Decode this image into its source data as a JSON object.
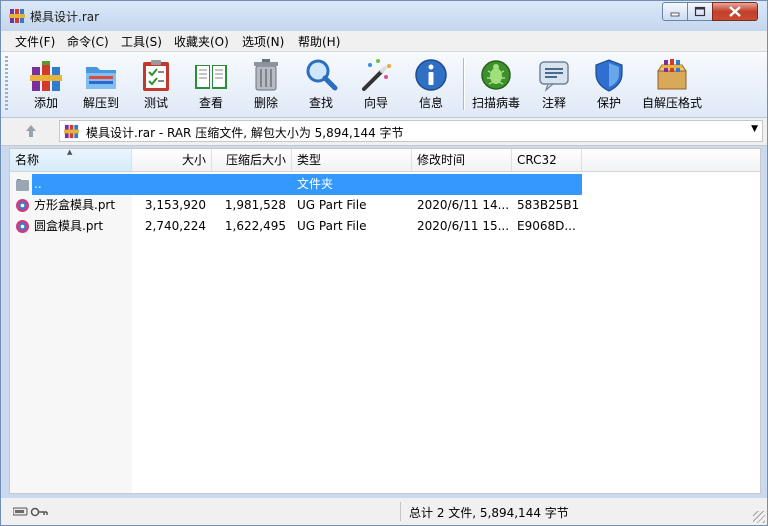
{
  "window": {
    "title": "模具设计.rar"
  },
  "menu": [
    "文件(F)",
    "命令(C)",
    "工具(S)",
    "收藏夹(O)",
    "选项(N)",
    "帮助(H)"
  ],
  "toolbar": [
    {
      "label": "添加",
      "icon": "add-archive-icon"
    },
    {
      "label": "解压到",
      "icon": "extract-folder-icon"
    },
    {
      "label": "测试",
      "icon": "test-clipboard-icon"
    },
    {
      "label": "查看",
      "icon": "view-book-icon"
    },
    {
      "label": "删除",
      "icon": "delete-trash-icon"
    },
    {
      "label": "查找",
      "icon": "find-magnifier-icon"
    },
    {
      "label": "向导",
      "icon": "wizard-wand-icon"
    },
    {
      "label": "信息",
      "icon": "info-icon"
    },
    {
      "label": "扫描病毒",
      "icon": "virus-scan-icon"
    },
    {
      "label": "注释",
      "icon": "comment-icon"
    },
    {
      "label": "保护",
      "icon": "shield-icon"
    },
    {
      "label": "自解压格式",
      "icon": "sfx-box-icon"
    }
  ],
  "address": {
    "text": "模具设计.rar - RAR 压缩文件, 解包大小为 5,894,144 字节"
  },
  "columns": [
    "名称",
    "大小",
    "压缩后大小",
    "类型",
    "修改时间",
    "CRC32"
  ],
  "rows": [
    {
      "name": "..",
      "size": "",
      "packed": "",
      "type": "文件夹",
      "modified": "",
      "crc": "",
      "selected": true
    },
    {
      "name": "方形盒模具.prt",
      "size": "3,153,920",
      "packed": "1,981,528",
      "type": "UG Part File",
      "modified": "2020/6/11 14...",
      "crc": "583B25B1",
      "selected": false
    },
    {
      "name": "圆盒模具.prt",
      "size": "2,740,224",
      "packed": "1,622,495",
      "type": "UG Part File",
      "modified": "2020/6/11 15...",
      "crc": "E9068D...",
      "selected": false
    }
  ],
  "status": {
    "text": "总计 2 文件, 5,894,144 字节"
  },
  "colors": {
    "selection": "#3399ff",
    "titlebar": "#c4d6ee",
    "close": "#c94b31"
  }
}
